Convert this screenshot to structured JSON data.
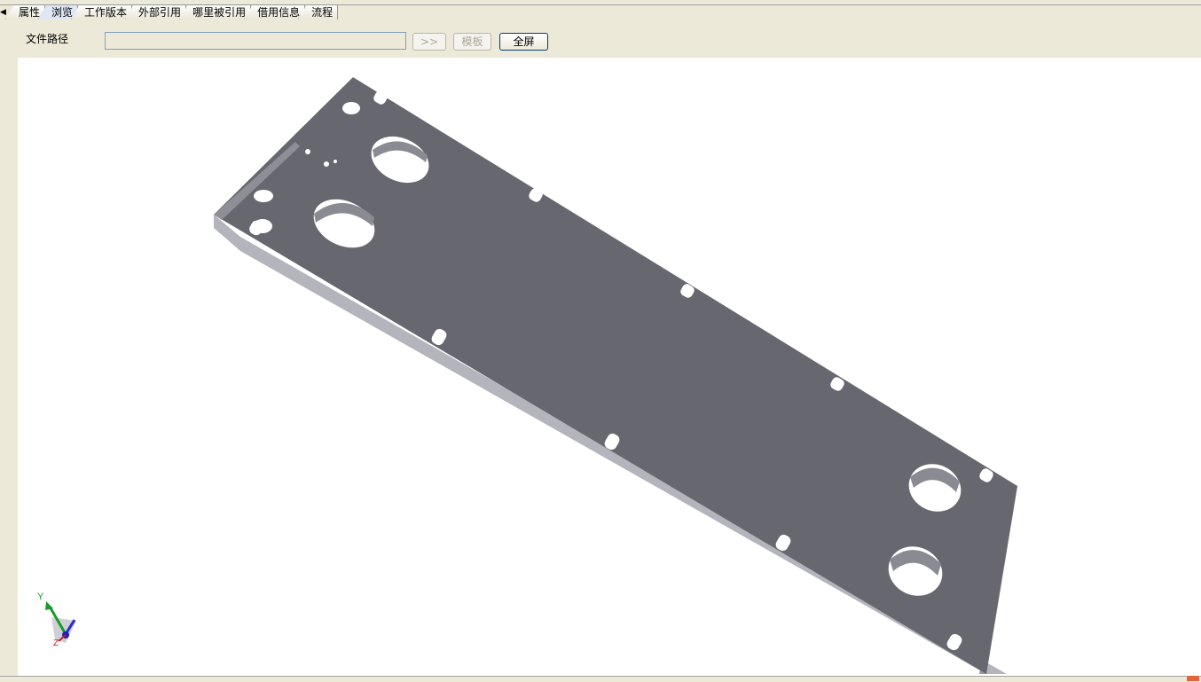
{
  "tabs": [
    {
      "label": "属性",
      "active": false
    },
    {
      "label": "浏览",
      "active": true
    },
    {
      "label": "工作版本",
      "active": false
    },
    {
      "label": "外部引用",
      "active": false
    },
    {
      "label": "哪里被引用",
      "active": false
    },
    {
      "label": "借用信息",
      "active": false
    },
    {
      "label": "流程",
      "active": false
    }
  ],
  "toolbar": {
    "path_label": "文件路径",
    "path_value": "",
    "go_label": ">>",
    "template_label": "模板",
    "fullscreen_label": "全屏"
  },
  "viewer": {
    "axis_y_label": "Y",
    "axis_z_label": "Z",
    "plate_color": "#67676f",
    "edge_color": "#b4b4bc",
    "hole_color": "#ffffff"
  }
}
